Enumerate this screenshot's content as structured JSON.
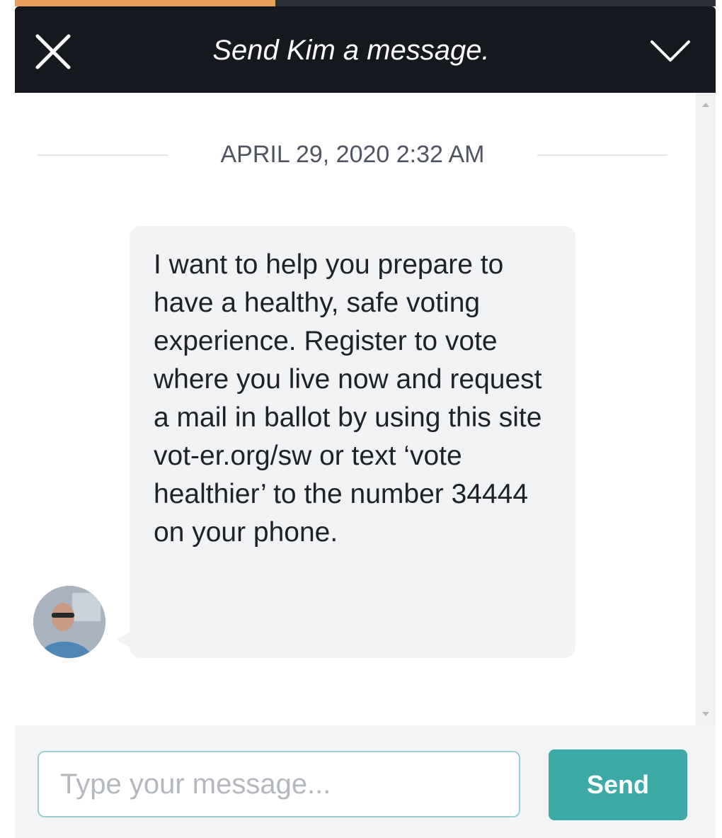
{
  "header": {
    "title": "Send Kim a message.",
    "close_icon": "close-icon",
    "collapse_icon": "chevron-down-icon"
  },
  "conversation": {
    "date_divider": "APRIL 29, 2020 2:32 AM",
    "messages": [
      {
        "sender_avatar": "avatar",
        "text": "I want to help you prepare to have a healthy, safe voting experience. Register to vote where you live now and request a mail in ballot by using this site vot-er.org/sw or text ‘vote healthier’ to the number 34444 on your phone."
      }
    ]
  },
  "composer": {
    "input_value": "",
    "input_placeholder": "Type your message...",
    "send_label": "Send"
  },
  "colors": {
    "header_bg": "#15191f",
    "bubble_bg": "#f1f2f3",
    "send_button": "#3eaaa6",
    "input_border": "#9ccfd3"
  }
}
